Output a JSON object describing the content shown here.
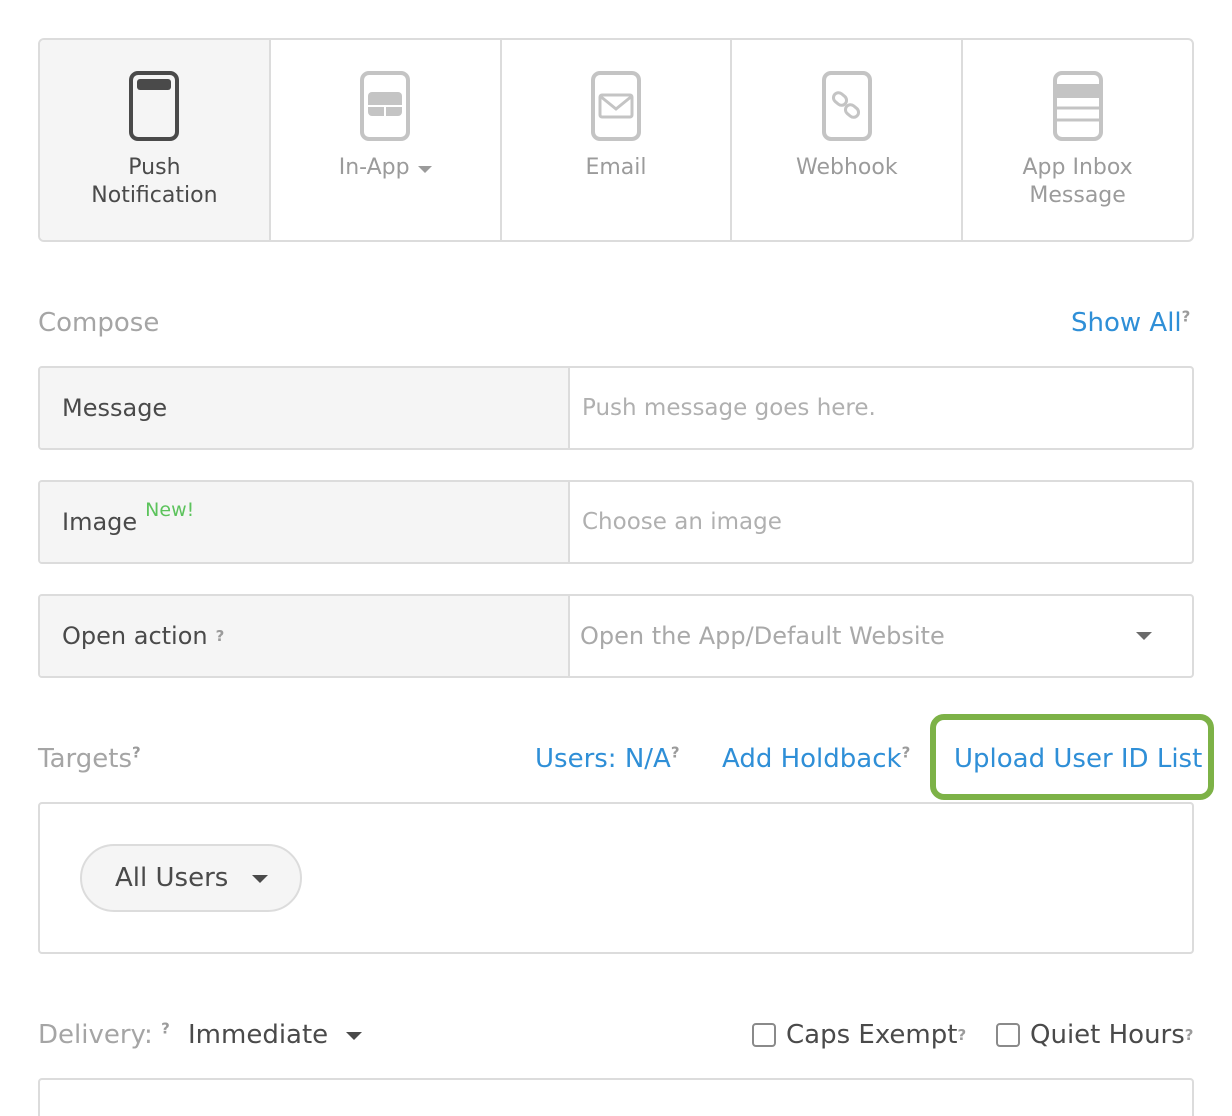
{
  "channels": [
    {
      "label": "Push\nNotification",
      "icon": "push-phone-icon",
      "active": true
    },
    {
      "label": "In-App",
      "icon": "in-app-phone-icon",
      "dropdown": true
    },
    {
      "label": "Email",
      "icon": "email-phone-icon"
    },
    {
      "label": "Webhook",
      "icon": "webhook-link-icon"
    },
    {
      "label": "App Inbox\nMessage",
      "icon": "inbox-list-icon"
    }
  ],
  "compose": {
    "title": "Compose",
    "show_all": "Show All",
    "help": "?",
    "rows": {
      "message": {
        "label": "Message",
        "placeholder": "Push message goes here."
      },
      "image": {
        "label": "Image",
        "badge": "New!",
        "placeholder": "Choose an image"
      },
      "open_action": {
        "label": "Open action",
        "help": "?",
        "value": "Open the App/Default Website"
      }
    }
  },
  "targets": {
    "title": "Targets",
    "help": "?",
    "users": "Users: N/A",
    "holdback": "Add Holdback",
    "upload": "Upload User ID List",
    "segment": "All Users"
  },
  "delivery": {
    "title": "Delivery:",
    "help": "?",
    "value": "Immediate",
    "caps_exempt": "Caps Exempt",
    "quiet_hours": "Quiet Hours"
  },
  "colors": {
    "accent": "#2f8fd7",
    "highlight": "#7db247",
    "new_badge": "#5cc35c"
  }
}
